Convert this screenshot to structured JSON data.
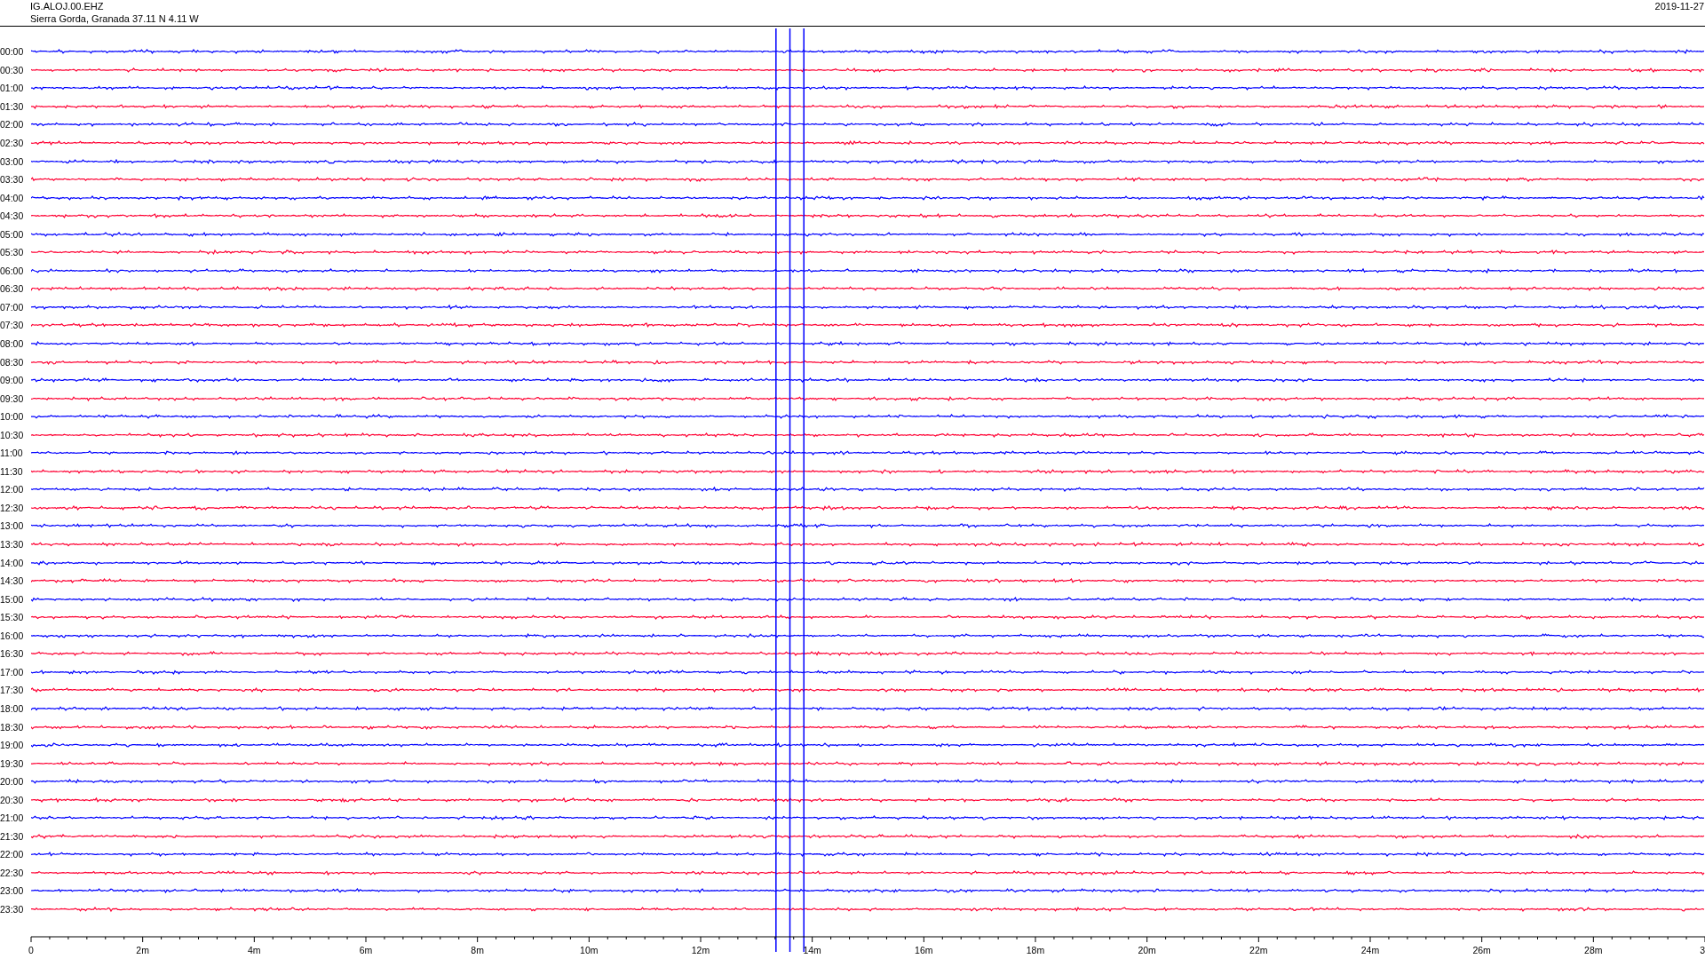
{
  "header": {
    "station": "IG.ALOJ.00.EHZ",
    "location": "Sierra Gorda, Granada  37.11 N 4.11 W",
    "date": "2019-11-27"
  },
  "traces": [
    {
      "label": "00:00",
      "color": "#0000ff"
    },
    {
      "label": "00:30",
      "color": "#ff0033"
    },
    {
      "label": "01:00",
      "color": "#0000ff"
    },
    {
      "label": "01:30",
      "color": "#ff0033"
    },
    {
      "label": "02:00",
      "color": "#0000ff"
    },
    {
      "label": "02:30",
      "color": "#ff0033"
    },
    {
      "label": "03:00",
      "color": "#0000ff"
    },
    {
      "label": "03:30",
      "color": "#ff0033"
    },
    {
      "label": "04:00",
      "color": "#0000ff"
    },
    {
      "label": "04:30",
      "color": "#ff0033"
    },
    {
      "label": "05:00",
      "color": "#0000ff"
    },
    {
      "label": "05:30",
      "color": "#ff0033"
    },
    {
      "label": "06:00",
      "color": "#0000ff"
    },
    {
      "label": "06:30",
      "color": "#ff0033"
    },
    {
      "label": "07:00",
      "color": "#0000ff"
    },
    {
      "label": "07:30",
      "color": "#ff0033"
    },
    {
      "label": "08:00",
      "color": "#0000ff"
    },
    {
      "label": "08:30",
      "color": "#ff0033"
    },
    {
      "label": "09:00",
      "color": "#0000ff"
    },
    {
      "label": "09:30",
      "color": "#ff0033"
    },
    {
      "label": "10:00",
      "color": "#0000ff"
    },
    {
      "label": "10:30",
      "color": "#ff0033"
    },
    {
      "label": "11:00",
      "color": "#0000ff"
    },
    {
      "label": "11:30",
      "color": "#ff0033"
    },
    {
      "label": "12:00",
      "color": "#0000ff"
    },
    {
      "label": "12:30",
      "color": "#ff0033"
    },
    {
      "label": "13:00",
      "color": "#0000ff"
    },
    {
      "label": "13:30",
      "color": "#ff0033"
    },
    {
      "label": "14:00",
      "color": "#0000ff"
    },
    {
      "label": "14:30",
      "color": "#ff0033"
    },
    {
      "label": "15:00",
      "color": "#0000ff"
    },
    {
      "label": "15:30",
      "color": "#ff0033"
    },
    {
      "label": "16:00",
      "color": "#0000ff"
    },
    {
      "label": "16:30",
      "color": "#ff0033"
    },
    {
      "label": "17:00",
      "color": "#0000ff"
    },
    {
      "label": "17:30",
      "color": "#ff0033"
    },
    {
      "label": "18:00",
      "color": "#0000ff"
    },
    {
      "label": "18:30",
      "color": "#ff0033"
    },
    {
      "label": "19:00",
      "color": "#0000ff"
    },
    {
      "label": "19:30",
      "color": "#ff0033"
    },
    {
      "label": "20:00",
      "color": "#0000ff"
    },
    {
      "label": "20:30",
      "color": "#ff0033"
    },
    {
      "label": "21:00",
      "color": "#0000ff"
    },
    {
      "label": "21:30",
      "color": "#ff0033"
    },
    {
      "label": "22:00",
      "color": "#0000ff"
    },
    {
      "label": "22:30",
      "color": "#ff0033"
    },
    {
      "label": "23:00",
      "color": "#0000ff"
    },
    {
      "label": "23:30",
      "color": "#ff0033"
    }
  ],
  "axis": {
    "labels": [
      "0",
      "2m",
      "4m",
      "6m",
      "8m",
      "10m",
      "12m",
      "14m",
      "16m",
      "18m",
      "20m",
      "22m",
      "24m",
      "26m",
      "28m",
      "3"
    ]
  }
}
